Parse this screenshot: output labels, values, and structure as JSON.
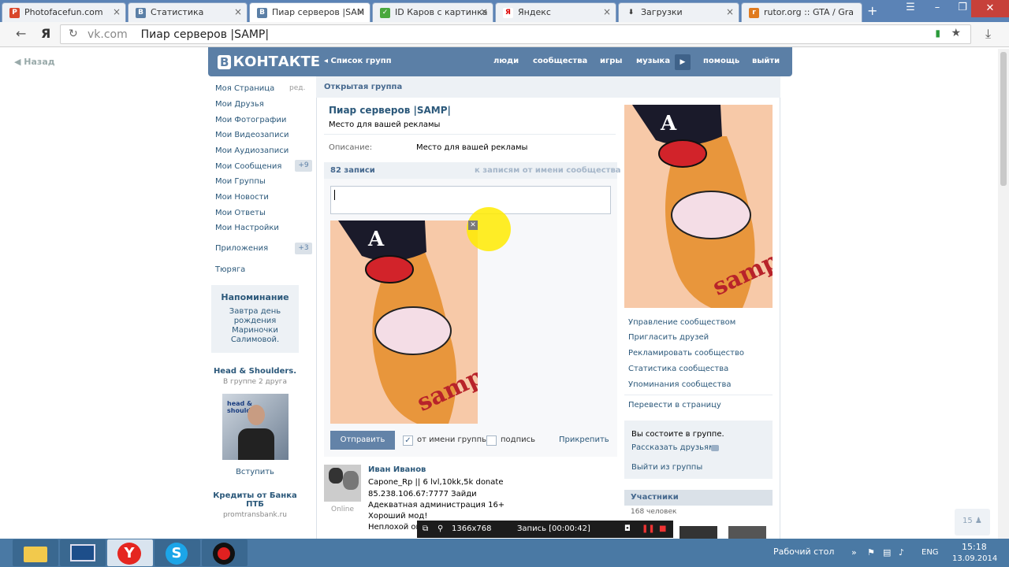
{
  "browser": {
    "tabs": [
      {
        "label": "Photofacefun.com",
        "icon": "P"
      },
      {
        "label": "Статистика",
        "icon": "B"
      },
      {
        "label": "Пиар серверов |SAM",
        "icon": "B",
        "active": true
      },
      {
        "label": "ID Каров с картинка",
        "icon": "✓"
      },
      {
        "label": "Яндекс",
        "icon": "Я"
      },
      {
        "label": "Загрузки",
        "icon": "⬇"
      },
      {
        "label": "rutor.org :: GTA / Gra",
        "icon": "r"
      }
    ],
    "url_host": "vk.com",
    "url_title": "Пиар серверов |SAMP|"
  },
  "vk": {
    "back": "Назад",
    "logo_b": "В",
    "logo_text": "КОНТАКТЕ",
    "groups_list": "◂ Список групп",
    "nav": [
      "люди",
      "сообщества",
      "игры",
      "музыка",
      "помощь",
      "выйти"
    ],
    "left_menu": [
      "Моя Страница",
      "Мои Друзья",
      "Мои Фотографии",
      "Мои Видеозаписи",
      "Мои Аудиозаписи",
      "Мои Сообщения",
      "Мои Группы",
      "Мои Новости",
      "Мои Ответы",
      "Мои Настройки",
      "Приложения",
      "Тюряга"
    ],
    "edit": "ред.",
    "messages_badge": "+9",
    "apps_badge": "+3",
    "reminder_title": "Напоминание",
    "reminder_text": "Завтра день рождения Мариночки Салимовой.",
    "ad1_title": "Head & Shoulders.",
    "ad1_sub": "В группе 2 друга",
    "ad1_join": "Вступить",
    "ad1_logo": "head & shoulders",
    "ad2_title": "Кредиты от Банка ПТБ",
    "ad2_sub": "promtransbank.ru"
  },
  "group": {
    "type": "Открытая группа",
    "name": "Пиар серверов |SAMP|",
    "status": "Место для вашей рекламы",
    "desc_label": "Описание:",
    "desc_value": "Место для вашей рекламы",
    "posts_count": "82 записи",
    "posts_filter": "к записям от имени сообщества",
    "send": "Отправить",
    "as_group": "от имени группы",
    "signature": "подпись",
    "attach": "Прикрепить",
    "post": {
      "author": "Иван Иванов",
      "online": "Online",
      "lines": [
        "Capone_Rp || 6 lvl,10kk,5k donate",
        "85.238.106.67:7777 Зайди",
        "Адекватная администрация 16+",
        "Хороший мод!",
        "Неплохой онл"
      ]
    }
  },
  "right": {
    "links": [
      "Управление сообществом",
      "Пригласить друзей",
      "Рекламировать сообщество",
      "Статистика сообщества",
      "Упоминания сообщества"
    ],
    "convert": "Перевести в страницу",
    "member_text": "Вы состоите в группе.",
    "tell_friends": "Рассказать друзьям",
    "leave": "Выйти из группы",
    "members_title": "Участники",
    "members_count": "168 человек",
    "art_text": "samp"
  },
  "likes": "15",
  "recorder": {
    "resolution": "1366x768",
    "status": "Запись [00:00:42]"
  },
  "taskbar": {
    "desktop": "Рабочий стол",
    "lang": "ENG",
    "time": "15:18",
    "date": "13.09.2014"
  }
}
